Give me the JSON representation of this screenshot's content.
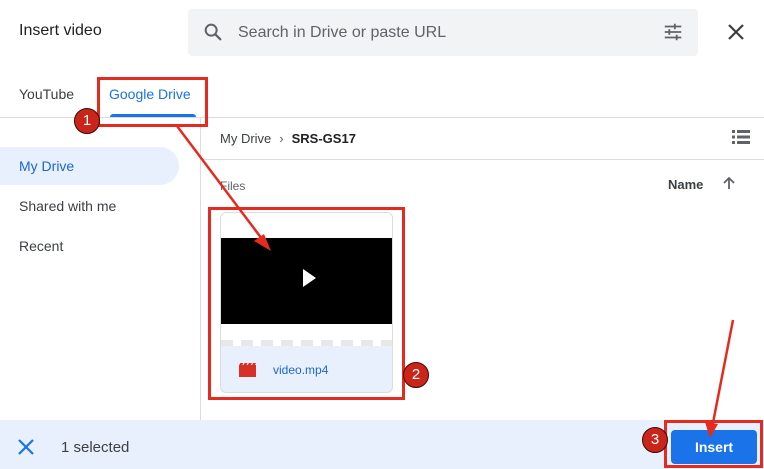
{
  "dialog": {
    "title": "Insert video"
  },
  "search": {
    "placeholder": "Search in Drive or paste URL",
    "value": ""
  },
  "tabs": [
    {
      "label": "YouTube"
    },
    {
      "label": "Google Drive"
    }
  ],
  "sidebar": {
    "items": [
      {
        "label": "My Drive"
      },
      {
        "label": "Shared with me"
      },
      {
        "label": "Recent"
      }
    ]
  },
  "breadcrumb": {
    "root": "My Drive",
    "current": "SRS-GS17"
  },
  "files": {
    "section_label": "Files",
    "sort_label": "Name",
    "items": [
      {
        "name": "video.mp4"
      }
    ]
  },
  "footer": {
    "selected_text": "1 selected",
    "insert_label": "Insert"
  },
  "annotations": {
    "badges": [
      "1",
      "2",
      "3"
    ]
  },
  "colors": {
    "accent": "#1a73e8",
    "selection": "#e8f0fe",
    "annotation": "#e52b1f",
    "file_icon": "#d93025"
  },
  "icons": [
    "search-icon",
    "tune-icon",
    "close-icon",
    "list-view-icon",
    "arrow-up-icon",
    "play-icon",
    "video-file-icon",
    "deselect-icon"
  ]
}
